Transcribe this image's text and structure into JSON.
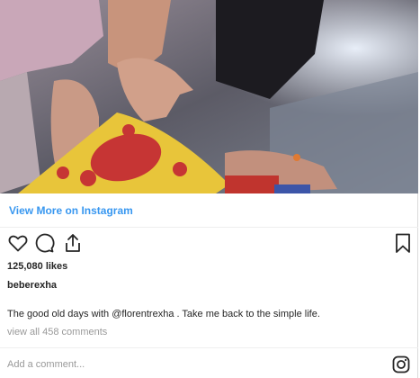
{
  "post": {
    "photo_icon": "instagram-photo-child-hand-toy",
    "view_more_label": "View More on Instagram",
    "likes": "125,080 likes",
    "username": "beberexha",
    "caption_prefix": "The good old days with ",
    "caption_mention": "@florentrexha",
    "caption_suffix": " . Take me back to the simple life.",
    "view_comments": "view all 458 comments",
    "comment_placeholder": "Add a comment...",
    "icons": {
      "heart": "heart-icon",
      "comment": "comment-icon",
      "share": "share-icon",
      "bookmark": "bookmark-icon",
      "instagram": "instagram-logo-icon"
    },
    "colors": {
      "link": "#3897f0",
      "text": "#262626",
      "muted": "#999999",
      "divider": "#efefef"
    }
  }
}
